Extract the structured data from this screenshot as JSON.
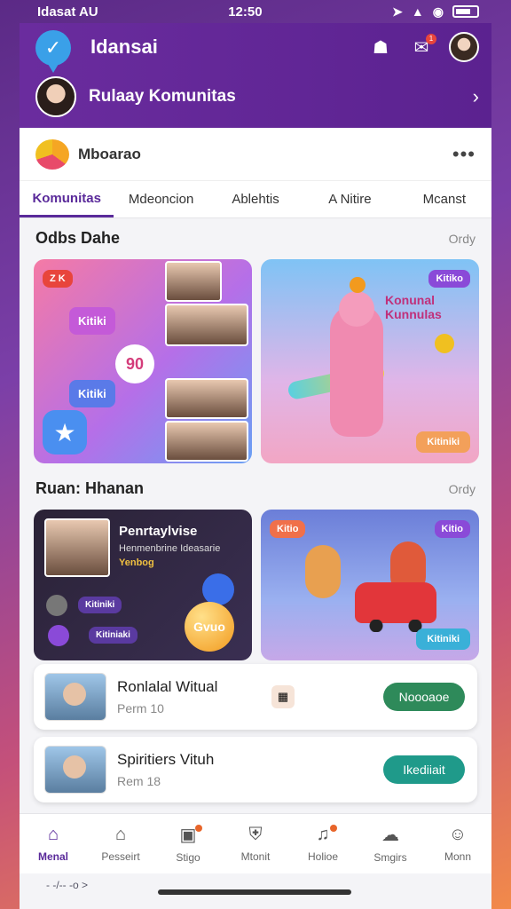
{
  "status_bar": {
    "carrier": "Idasat AU",
    "time": "12:50"
  },
  "app": {
    "title": "Idansai",
    "notification_count": "1"
  },
  "community_row": {
    "label": "Rulaay Komunitas"
  },
  "brand": {
    "name": "Mboarao"
  },
  "tabs": [
    {
      "label": "Komunitas",
      "active": true
    },
    {
      "label": "Mdeoncion"
    },
    {
      "label": "Ablehtis"
    },
    {
      "label": "A Nitire"
    },
    {
      "label": "Mcanst"
    }
  ],
  "section1": {
    "title": "Odbs Dahe",
    "link": "Ordy"
  },
  "card1": {
    "tag": "Z K",
    "badge": "90",
    "sticker1": "Kitiki",
    "sticker2": "Kitiki"
  },
  "card2": {
    "badge": "Kitiko",
    "title": "Konunal Kunnulas",
    "button": "Kitiniki"
  },
  "section2": {
    "title": "Ruan: Hhanan",
    "link": "Ordy"
  },
  "card3": {
    "title": "Penrtaylvise",
    "subtitle": "Henmenbrine Ideasarie",
    "meta": "Yenbog",
    "chip1": "Kitiniki",
    "chip2": "Kitiniaki",
    "balloon": "Gvuo"
  },
  "card4": {
    "tag": "Kitio",
    "badge": "Kitio",
    "button": "Kitiniki"
  },
  "list_items": [
    {
      "title": "Ronlalal Witual",
      "sub": "Perm 10",
      "button": "Noooaoe",
      "color": "#2e8a5a"
    },
    {
      "title": "Spiritiers Vituh",
      "sub": "Rem 18",
      "button": "Ikediiait",
      "color": "#1f9a8a"
    }
  ],
  "bottom_nav": [
    {
      "label": "Menal",
      "active": true
    },
    {
      "label": "Pesseirt"
    },
    {
      "label": "Stigo"
    },
    {
      "label": "Mtonit"
    },
    {
      "label": "Holioe"
    },
    {
      "label": "Smgirs"
    },
    {
      "label": "Monn"
    }
  ],
  "footer": {
    "text": "- -/-- -o >"
  },
  "colors": {
    "primary": "#5a2a9a",
    "appbar": "#6a2c9e",
    "accent_green": "#2e8a5a"
  }
}
